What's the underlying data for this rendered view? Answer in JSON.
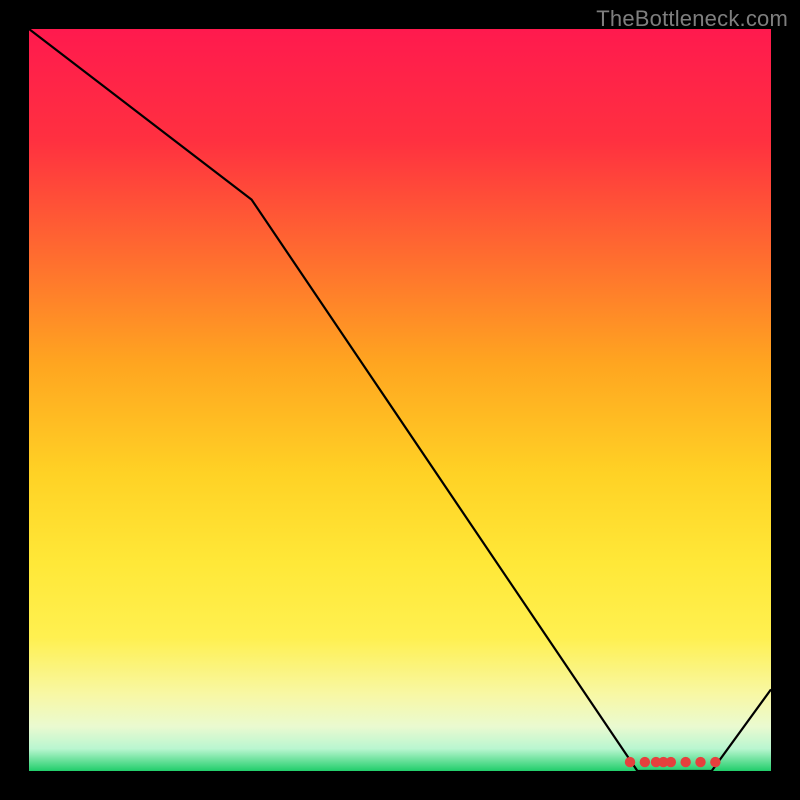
{
  "watermark": "TheBottleneck.com",
  "chart_data": {
    "type": "line",
    "title": "",
    "xlabel": "",
    "ylabel": "",
    "xlim": [
      0,
      100
    ],
    "ylim": [
      0,
      100
    ],
    "grid": false,
    "legend": false,
    "line": {
      "x": [
        0,
        30,
        82,
        92,
        100
      ],
      "y": [
        100,
        77,
        0,
        0,
        11
      ]
    },
    "markers": {
      "x": [
        81,
        83,
        84.5,
        85.5,
        86.5,
        88.5,
        90.5,
        92.5
      ],
      "y": [
        1.2,
        1.2,
        1.2,
        1.2,
        1.2,
        1.2,
        1.2,
        1.2
      ]
    },
    "gradient_stops": [
      {
        "offset": 0.0,
        "color": "#ff1a4e"
      },
      {
        "offset": 0.15,
        "color": "#ff3040"
      },
      {
        "offset": 0.3,
        "color": "#ff6a30"
      },
      {
        "offset": 0.45,
        "color": "#ffa520"
      },
      {
        "offset": 0.6,
        "color": "#ffd225"
      },
      {
        "offset": 0.72,
        "color": "#ffe838"
      },
      {
        "offset": 0.82,
        "color": "#fff050"
      },
      {
        "offset": 0.9,
        "color": "#f7f8a8"
      },
      {
        "offset": 0.94,
        "color": "#eafad0"
      },
      {
        "offset": 0.97,
        "color": "#b9f6d0"
      },
      {
        "offset": 1.0,
        "color": "#21ce6b"
      }
    ],
    "marker_color": "#e5403d",
    "line_color": "#000000",
    "line_width": 2.2
  }
}
